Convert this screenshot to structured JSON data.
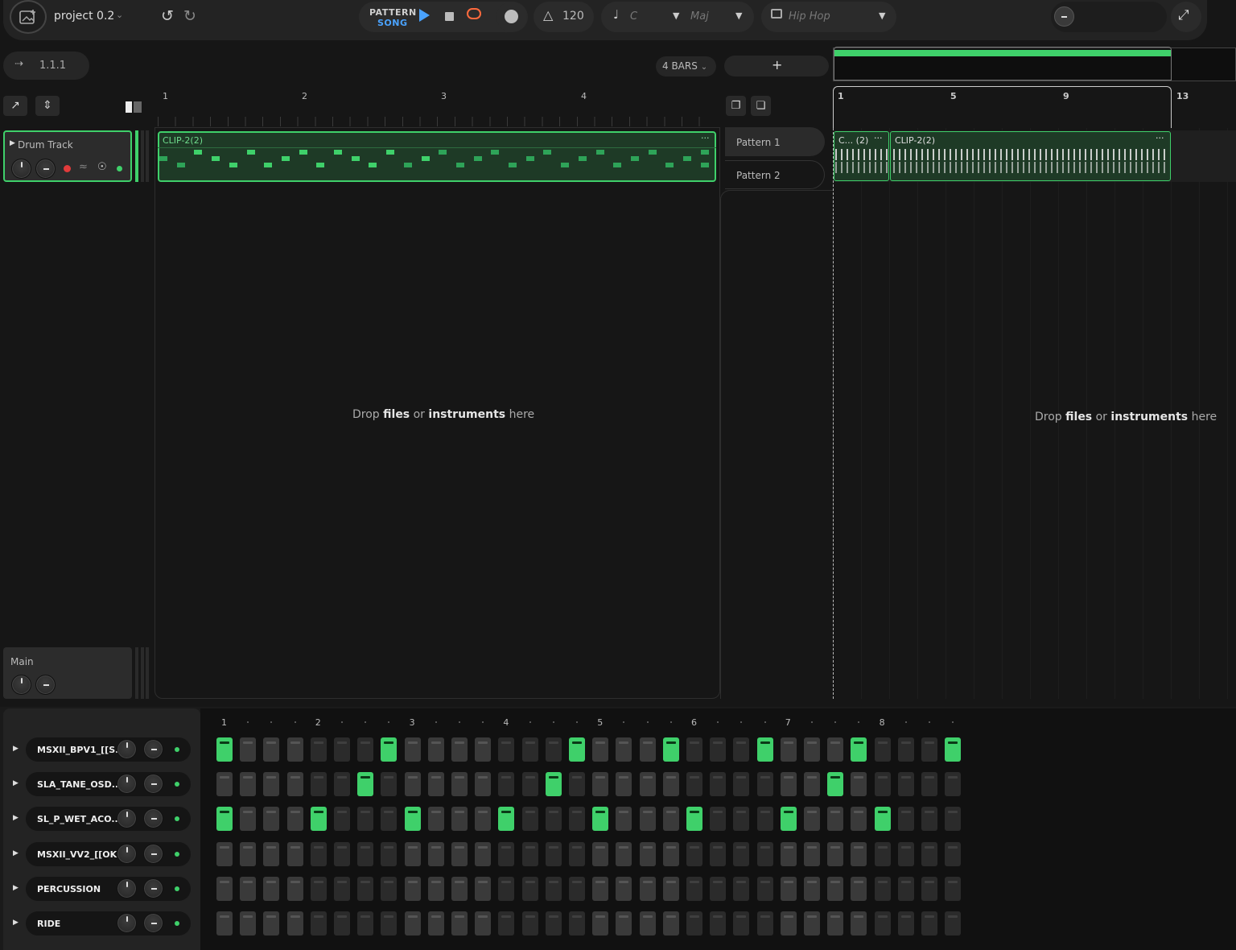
{
  "header": {
    "project_name": "project 0.2",
    "transport": {
      "pattern_label": "PATTERN",
      "song_label": "SONG"
    },
    "tempo": "120",
    "key": "C",
    "scale": "Maj",
    "genre": "Hip Hop"
  },
  "position": "1.1.1",
  "pattern_length": "4 BARS",
  "add_pattern_label": "+",
  "pattern_ruler": [
    "1",
    "2",
    "3",
    "4"
  ],
  "song_ruler": [
    "1",
    "5",
    "9",
    "13"
  ],
  "tracks": [
    {
      "name": "Drum Track"
    },
    {
      "name": "Main"
    }
  ],
  "pattern_clip": {
    "name": "CLIP-2(2)",
    "menu": "···"
  },
  "patterns": [
    "Pattern 1",
    "Pattern 2"
  ],
  "song_clips": [
    {
      "name": "C... (2)",
      "menu": "···"
    },
    {
      "name": "CLIP-2(2)",
      "menu": "···"
    }
  ],
  "drop_hint": {
    "pre": "Drop ",
    "files": "files",
    "mid": " or ",
    "instruments": "instruments",
    "post": " here"
  },
  "sequencer": {
    "beats": [
      "1",
      "2",
      "3",
      "4",
      "5",
      "6",
      "7",
      "8"
    ],
    "rows": [
      {
        "name": "MSXII_BPV1_[[S...",
        "on": [
          0,
          7,
          15,
          19,
          23,
          27,
          31
        ]
      },
      {
        "name": "SLA_TANE_OSD...",
        "on": [
          6,
          14,
          26
        ]
      },
      {
        "name": "SL_P_WET_ACO...",
        "on": [
          0,
          4,
          8,
          12,
          16,
          20,
          24,
          28
        ]
      },
      {
        "name": "MSXII_VV2_[[OK...",
        "on": []
      },
      {
        "name": "PERCUSSION",
        "on": []
      },
      {
        "name": "RIDE",
        "on": []
      }
    ]
  },
  "colors": {
    "accent": "#3fd06a",
    "song_blue": "#4aa3ff",
    "loop": "#ff6a3d",
    "record": "#e23b3b"
  }
}
